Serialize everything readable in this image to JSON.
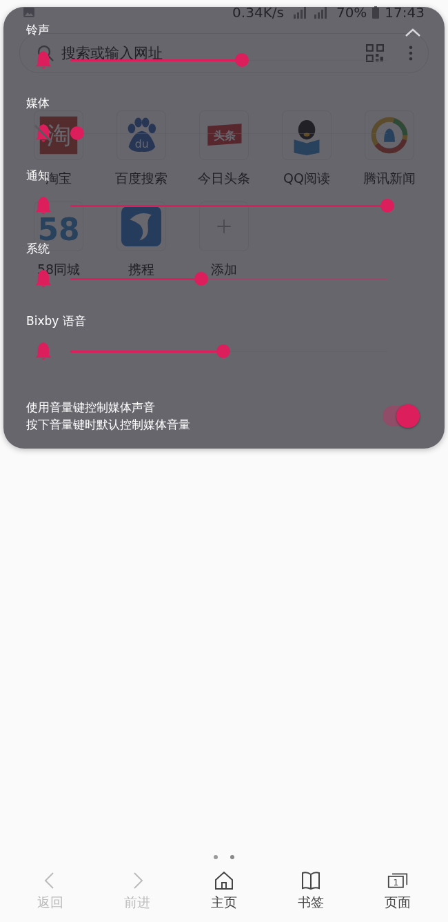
{
  "status_bar": {
    "network_speed": "0.34K/s",
    "battery": "70%",
    "time": "17:43"
  },
  "search": {
    "placeholder": "搜索或输入网址"
  },
  "shortcuts": [
    {
      "kind": "taobao",
      "label": "淘宝",
      "icon_text": "淘"
    },
    {
      "kind": "baidu",
      "label": "百度搜索",
      "icon_text": "du"
    },
    {
      "kind": "toutiao",
      "label": "今日头条",
      "icon_text": "头条"
    },
    {
      "kind": "qq_reader",
      "label": "QQ阅读"
    },
    {
      "kind": "tencent_news",
      "label": "腾讯新闻"
    },
    {
      "kind": "city58",
      "label": "58同城",
      "icon_text": "58"
    },
    {
      "kind": "ctrip",
      "label": "携程"
    },
    {
      "kind": "add",
      "label": "添加"
    }
  ],
  "bottom_nav": [
    {
      "kind": "back",
      "label": "返回",
      "disabled": true
    },
    {
      "kind": "forward",
      "label": "前进",
      "disabled": true
    },
    {
      "kind": "home",
      "label": "主页",
      "disabled": false
    },
    {
      "kind": "bookmarks",
      "label": "书签",
      "disabled": false
    },
    {
      "kind": "tabs",
      "label": "页面",
      "disabled": false,
      "count": "1"
    }
  ],
  "volume_panel": {
    "channels": [
      {
        "label": "铃声",
        "level": 0.53,
        "muted": false
      },
      {
        "label": "媒体",
        "level": 0,
        "muted": true
      },
      {
        "label": "通知",
        "level": 1,
        "muted": false
      },
      {
        "label": "系统",
        "level": 0.4,
        "muted": false
      },
      {
        "label": "Bixby 语音",
        "level": 0.47,
        "muted": false
      }
    ],
    "media_key": {
      "title": "使用音量键控制媒体声音",
      "subtitle": "按下音量键时默认控制媒体音量",
      "on": true
    }
  }
}
